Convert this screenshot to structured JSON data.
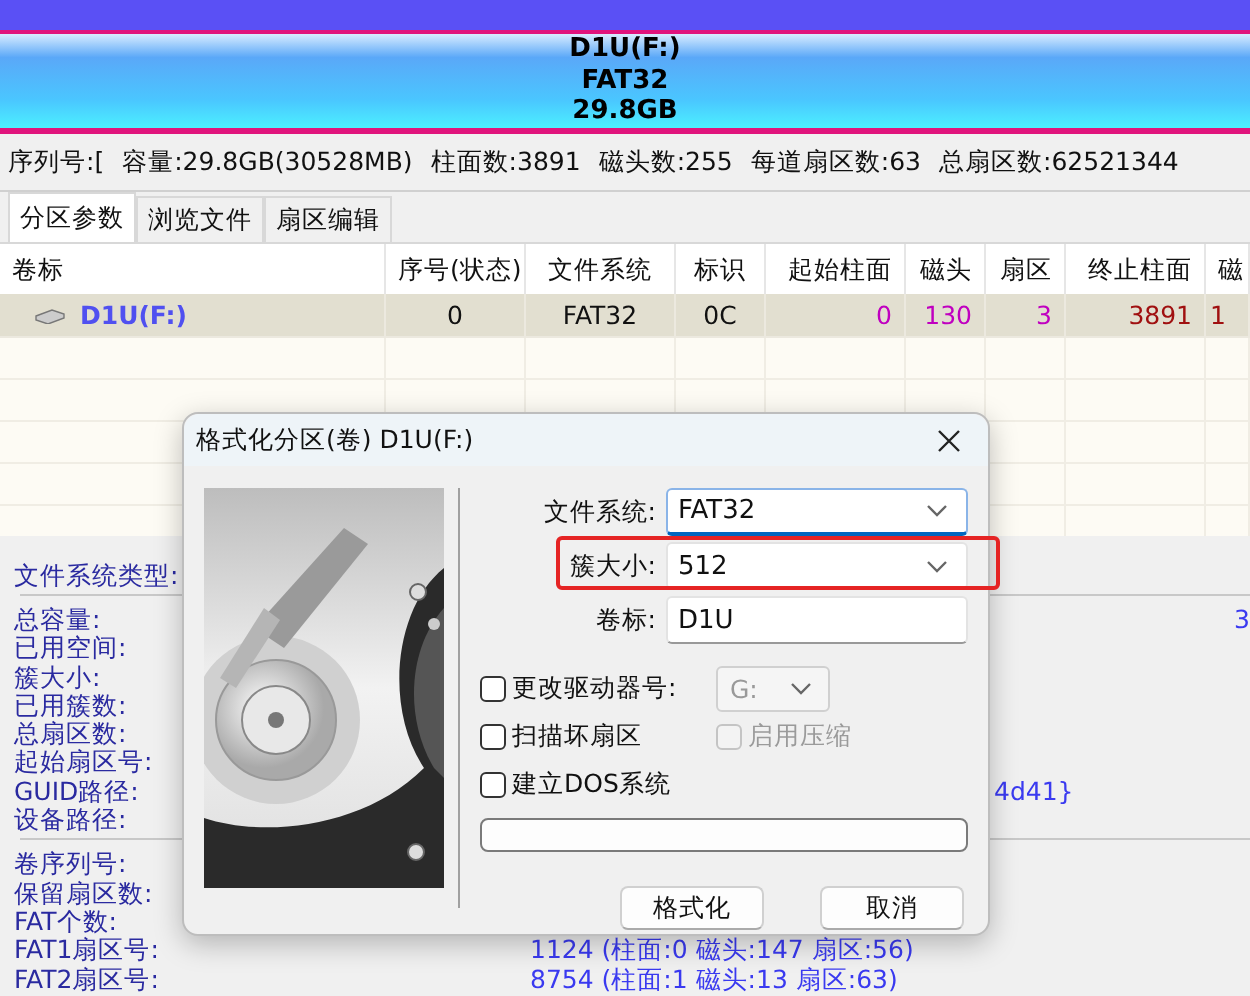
{
  "disk_bar": {
    "lines": [
      "D1U(F:)",
      "FAT32",
      "29.8GB"
    ]
  },
  "disk_info": [
    "序列号:[",
    "容量:29.8GB(30528MB)",
    "柱面数:3891",
    "磁头数:255",
    "每道扇区数:63",
    "总扇区数:62521344"
  ],
  "tabs": [
    {
      "label": "分区参数",
      "selected": true
    },
    {
      "label": "浏览文件",
      "selected": false
    },
    {
      "label": "扇区编辑",
      "selected": false
    }
  ],
  "partition_table": {
    "columns": [
      "卷标",
      "序号(状态)",
      "文件系统",
      "标识",
      "起始柱面",
      "磁头",
      "扇区",
      "终止柱面",
      "磁"
    ],
    "rows": [
      {
        "selected": true,
        "cells": [
          "D1U(F:)",
          "0",
          "FAT32",
          "0C",
          "0",
          "130",
          "3",
          "3891",
          "1"
        ]
      }
    ]
  },
  "details": {
    "title": "文件系统类型:",
    "groups": [
      [
        {
          "label": "总容量:",
          "value": "3",
          "kind": "number"
        },
        {
          "label": "已用空间:"
        },
        {
          "label": "簇大小:"
        },
        {
          "label": "已用簇数:"
        },
        {
          "label": "总扇区数:"
        },
        {
          "label": "起始扇区号:"
        },
        {
          "label": "GUID路径:",
          "value": "4d41}",
          "kind": "path"
        },
        {
          "label": "设备路径:"
        }
      ],
      [
        {
          "label": "卷序列号:"
        },
        {
          "label": "保留扇区数:"
        },
        {
          "label": "FAT个数:"
        },
        {
          "label": "FAT1扇区号:",
          "value": "1124 (柱面:0 磁头:147 扇区:56)",
          "kind": "sector"
        },
        {
          "label": "FAT2扇区号:",
          "value": "8754 (柱面:1 磁头:13 扇区:63)",
          "kind": "sector"
        }
      ]
    ]
  },
  "dialog": {
    "title": "格式化分区(卷) D1U(F:)",
    "fields": [
      {
        "label": "文件系统:",
        "value": "FAT32",
        "kind": "dropdown",
        "focused": true,
        "highlighted": false
      },
      {
        "label": "簇大小:",
        "value": "512",
        "kind": "dropdown",
        "focused": false,
        "highlighted": true
      },
      {
        "label": "卷标:",
        "value": "D1U",
        "kind": "text",
        "focused": false,
        "highlighted": false
      }
    ],
    "options": [
      [
        {
          "kind": "checkbox",
          "label": "更改驱动器号:",
          "checked": false,
          "disabled": false
        },
        {
          "kind": "dropdown",
          "value": "G:",
          "disabled": true
        }
      ],
      [
        {
          "kind": "checkbox",
          "label": "扫描坏扇区",
          "checked": false,
          "disabled": false
        },
        {
          "kind": "checkbox",
          "label": "启用压缩",
          "checked": false,
          "disabled": true
        }
      ],
      [
        {
          "kind": "checkbox",
          "label": "建立DOS系统",
          "checked": false,
          "disabled": false
        }
      ]
    ],
    "progress": {
      "level": 0
    },
    "buttons": [
      "格式化",
      "取消"
    ]
  }
}
